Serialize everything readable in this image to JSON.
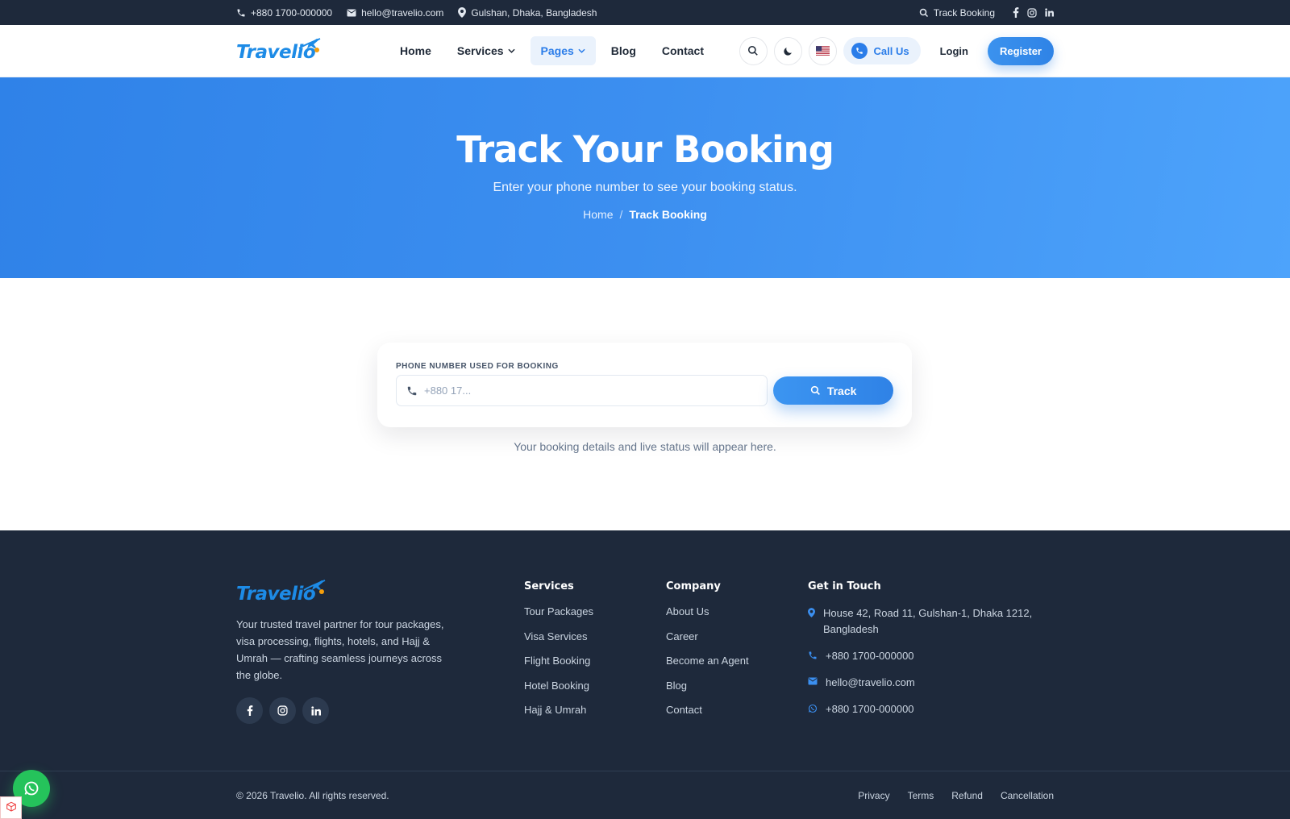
{
  "topbar": {
    "phone": "+880 1700-000000",
    "email": "hello@travelio.com",
    "location": "Gulshan, Dhaka, Bangladesh",
    "track_link": "Track Booking"
  },
  "brand": {
    "name": "Travelio",
    "color": "#1d8be6"
  },
  "nav": {
    "home": "Home",
    "services": "Services",
    "pages": "Pages",
    "blog": "Blog",
    "contact": "Contact"
  },
  "header": {
    "call_us": "Call Us",
    "login": "Login",
    "register": "Register"
  },
  "hero": {
    "title": "Track Your Booking",
    "subtitle": "Enter your phone number to see your booking status.",
    "breadcrumb_home": "Home",
    "breadcrumb_sep": "/",
    "breadcrumb_current": "Track Booking"
  },
  "track": {
    "label": "PHONE NUMBER USED FOR BOOKING",
    "placeholder": "+880 17...",
    "value": "",
    "button": "Track",
    "hint": "Your booking details and live status will appear here."
  },
  "footer": {
    "about": "Your trusted travel partner for tour packages, visa processing, flights, hotels, and Hajj & Umrah — crafting seamless journeys across the globe.",
    "services": {
      "title": "Services",
      "items": [
        "Tour Packages",
        "Visa Services",
        "Flight Booking",
        "Hotel Booking",
        "Hajj & Umrah"
      ]
    },
    "company": {
      "title": "Company",
      "items": [
        "About Us",
        "Career",
        "Become an Agent",
        "Blog",
        "Contact"
      ]
    },
    "contact": {
      "title": "Get in Touch",
      "address": "House 42, Road 11, Gulshan-1, Dhaka 1212, Bangladesh",
      "phone": "+880 1700-000000",
      "email": "hello@travelio.com",
      "whatsapp": "+880 1700-000000"
    },
    "copyright": "© 2026 Travelio. All rights reserved.",
    "legal": [
      "Privacy",
      "Terms",
      "Refund",
      "Cancellation"
    ]
  },
  "colors": {
    "primary": "#2f82e8",
    "dark": "#1e293b",
    "whatsapp": "#25c35b"
  }
}
